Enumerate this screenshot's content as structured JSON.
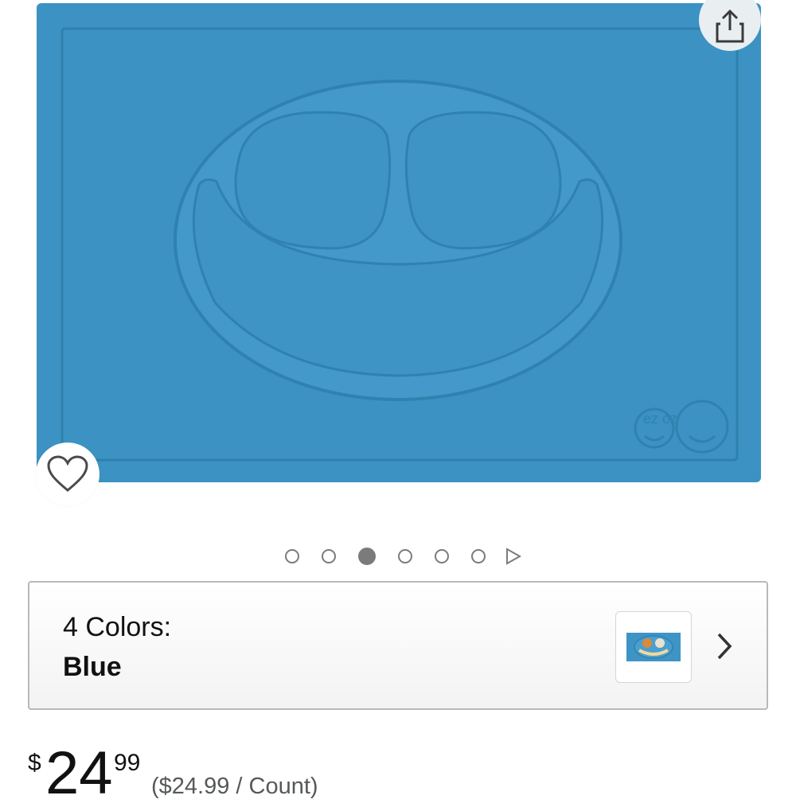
{
  "product_image": {
    "alt": "Blue silicone placemat with smiling face divided plate",
    "brand_mark": "ez oz",
    "mat_color": "#3d94c5",
    "mat_shadow": "#2f80ad"
  },
  "actions": {
    "share_icon": "share-icon",
    "wishlist_icon": "heart-icon"
  },
  "carousel": {
    "dot_count": 6,
    "active_index": 2,
    "next_icon": "play-triangle-icon"
  },
  "variant": {
    "label": "4 Colors:",
    "selected": "Blue",
    "chevron_icon": "chevron-right-icon"
  },
  "price": {
    "currency": "$",
    "whole": "24",
    "fraction": "99",
    "unit_price": "($24.99 / Count)"
  }
}
